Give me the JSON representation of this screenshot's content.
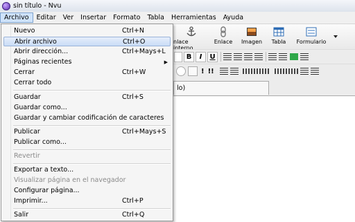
{
  "window": {
    "title": "sin título - Nvu"
  },
  "menubar": [
    "Archivo",
    "Editar",
    "Ver",
    "Insertar",
    "Formato",
    "Tabla",
    "Herramientas",
    "Ayuda"
  ],
  "toolbar": {
    "buttons": [
      "nlace interno",
      "Enlace",
      "Imagen",
      "Tabla",
      "Formulario"
    ],
    "format_bold": "B",
    "format_italic": "I",
    "format_underline": "U",
    "bang1": "!",
    "bang2": "!!"
  },
  "tab": {
    "label": "lo)"
  },
  "archivo_menu": [
    {
      "label": "Nuevo",
      "shortcut": "Ctrl+N"
    },
    {
      "label": "Abrir archivo",
      "shortcut": "Ctrl+O",
      "highlighted": true
    },
    {
      "label": "Abrir dirección...",
      "shortcut": "Ctrl+Mays+L"
    },
    {
      "label": "Páginas recientes",
      "shortcut": "",
      "submenu": true
    },
    {
      "label": "Cerrar",
      "shortcut": "Ctrl+W"
    },
    {
      "label": "Cerrar todo",
      "shortcut": ""
    },
    {
      "label": "Guardar",
      "shortcut": "Ctrl+S"
    },
    {
      "label": "Guardar como...",
      "shortcut": ""
    },
    {
      "label": "Guardar y cambiar codificación de caracteres",
      "shortcut": ""
    },
    {
      "label": "Publicar",
      "shortcut": "Ctrl+Mays+S"
    },
    {
      "label": "Publicar como...",
      "shortcut": ""
    },
    {
      "label": "Revertir",
      "shortcut": "",
      "disabled": true
    },
    {
      "label": "Exportar a texto...",
      "shortcut": ""
    },
    {
      "label": "Visualizar página en el navegador",
      "shortcut": "",
      "disabled": true
    },
    {
      "label": "Configurar página...",
      "shortcut": ""
    },
    {
      "label": "Imprimir...",
      "shortcut": "Ctrl+P"
    },
    {
      "label": "Salir",
      "shortcut": "Ctrl+Q"
    }
  ]
}
